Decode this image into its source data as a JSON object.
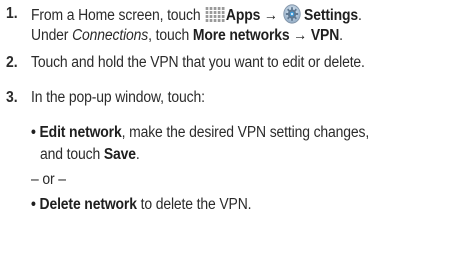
{
  "steps": [
    {
      "number": "1.",
      "line1": {
        "pre": "From a Home screen, touch",
        "apps_label": "Apps",
        "arrow": "→",
        "settings_label": "Settings",
        "end": "."
      },
      "line2": {
        "pre": "Under",
        "connections": "Connections",
        "comma_touch": ", touch",
        "more_networks": "More networks",
        "arrow": "→",
        "vpn": "VPN",
        "end": "."
      }
    },
    {
      "number": "2.",
      "text": "Touch and hold the VPN that you want to edit or delete."
    },
    {
      "number": "3.",
      "text": "In the pop-up window, touch:",
      "option1": {
        "bullet": "•",
        "bold": "Edit network",
        "rest": ", make the desired VPN setting changes,",
        "cont_pre": "and touch",
        "save": "Save",
        "end": "."
      },
      "or_text": "– or –",
      "option2": {
        "bullet": "•",
        "bold": "Delete network",
        "rest": " to delete the VPN."
      }
    }
  ],
  "icons": {
    "apps": "apps-grid-icon",
    "settings": "settings-gear-icon"
  }
}
